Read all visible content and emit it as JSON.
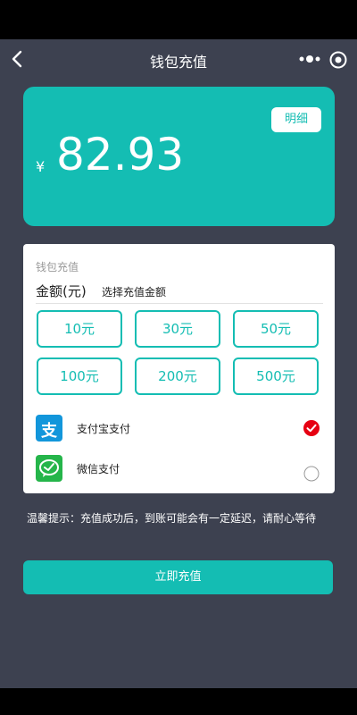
{
  "nav": {
    "title": "钱包充值"
  },
  "balance": {
    "currency_symbol": "¥",
    "amount": "82.93",
    "detail_label": "明细"
  },
  "recharge": {
    "section_title": "钱包充值",
    "amount_label": "金额(元)",
    "amount_hint": "选择充值金额",
    "options": [
      "10元",
      "30元",
      "50元",
      "100元",
      "200元",
      "500元"
    ]
  },
  "payment": {
    "alipay": {
      "label": "支付宝支付",
      "icon_glyph": "支",
      "selected": true,
      "icon": "alipay-icon"
    },
    "wechat": {
      "label": "微信支付",
      "selected": false,
      "icon": "wechat-pay-icon"
    }
  },
  "tip": "温馨提示：充值成功后，到账可能会有一定延迟，请耐心等待",
  "submit_label": "立即充值",
  "colors": {
    "accent": "#14bdb3",
    "background": "#3d4150",
    "selected_red": "#e60012",
    "alipay_blue": "#1296db",
    "wechat_green": "#25b54a"
  }
}
